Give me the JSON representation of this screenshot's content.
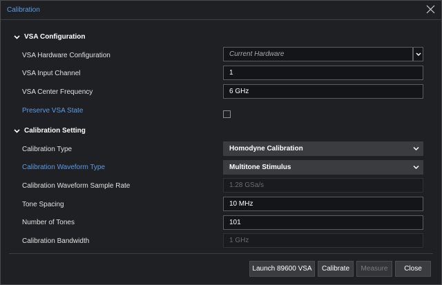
{
  "dialog": {
    "title": "Calibration"
  },
  "vsa_section": {
    "heading": "VSA Configuration",
    "hw_config_label": "VSA Hardware Configuration",
    "hw_config_value": "Current Hardware",
    "input_channel_label": "VSA Input Channel",
    "input_channel_value": "1",
    "center_freq_label": "VSA Center Frequency",
    "center_freq_value": "6 GHz",
    "preserve_label": "Preserve VSA State",
    "preserve_checked": false
  },
  "cal_section": {
    "heading": "Calibration Setting",
    "cal_type_label": "Calibration Type",
    "cal_type_value": "Homodyne Calibration",
    "waveform_type_label": "Calibration Waveform Type",
    "waveform_type_value": "Multitone Stimulus",
    "sample_rate_label": "Calibration Waveform Sample Rate",
    "sample_rate_value": "1.28 GSa/s",
    "tone_spacing_label": "Tone Spacing",
    "tone_spacing_value": "10 MHz",
    "num_tones_label": "Number of Tones",
    "num_tones_value": "101",
    "bandwidth_label": "Calibration Bandwidth",
    "bandwidth_value": "1 GHz"
  },
  "footer": {
    "launch_label": "Launch 89600 VSA",
    "calibrate_label": "Calibrate",
    "measure_label": "Measure",
    "close_label": "Close"
  },
  "colors": {
    "accent": "#5e9be8",
    "background": "#1f2023"
  }
}
